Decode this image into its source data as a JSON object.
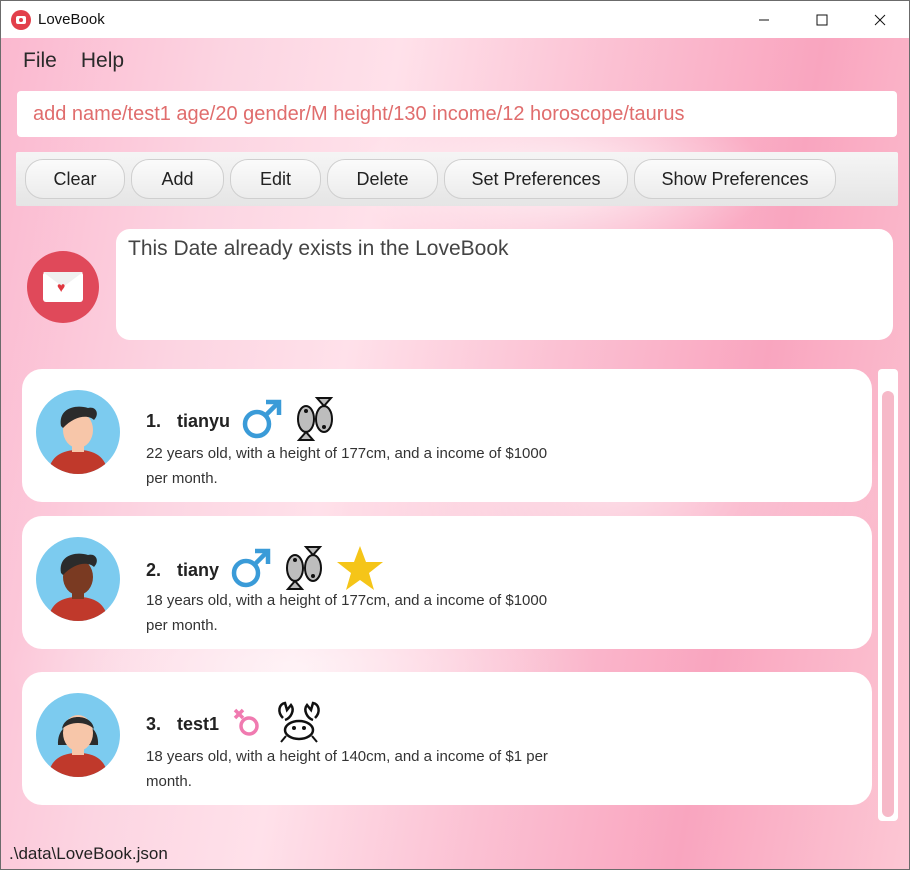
{
  "window": {
    "title": "LoveBook",
    "minimize": "—",
    "maximize": "☐",
    "close": "✕"
  },
  "menu": {
    "items": [
      "File",
      "Help"
    ]
  },
  "command": {
    "value": "add name/test1 age/20 gender/M height/130 income/12 horoscope/taurus"
  },
  "toolbar": {
    "buttons": [
      "Clear",
      "Add",
      "Edit",
      "Delete",
      "Set Preferences",
      "Show Preferences"
    ]
  },
  "result": {
    "message": "This Date already exists in the LoveBook"
  },
  "dates": [
    {
      "index": "1.",
      "name": "tianyu",
      "gender": "male",
      "horoscope": "pisces",
      "starred": false,
      "description": "22 years old, with a height of 177cm, and a income of $1000 per month.",
      "skin": "#f7c6a9",
      "hair": "#2b2b2b"
    },
    {
      "index": "2.",
      "name": "tiany",
      "gender": "male",
      "horoscope": "pisces",
      "starred": true,
      "description": "18 years old, with a height of 177cm, and a income of $1000 per month.",
      "skin": "#7a3a22",
      "hair": "#2b2b2b"
    },
    {
      "index": "3.",
      "name": "test1",
      "gender": "female",
      "horoscope": "cancer",
      "starred": false,
      "description": "18 years old, with a height of 140cm, and a income of $1 per month.",
      "skin": "#f7c6a9",
      "hair": "#2b2b2b"
    }
  ],
  "status": {
    "path": ".\\data\\LoveBook.json"
  },
  "colors": {
    "accent": "#e0495a",
    "male_symbol": "#3a9bd8",
    "female_symbol": "#f07ab0",
    "star": "#f5c518",
    "command_text": "#e06d6d"
  }
}
